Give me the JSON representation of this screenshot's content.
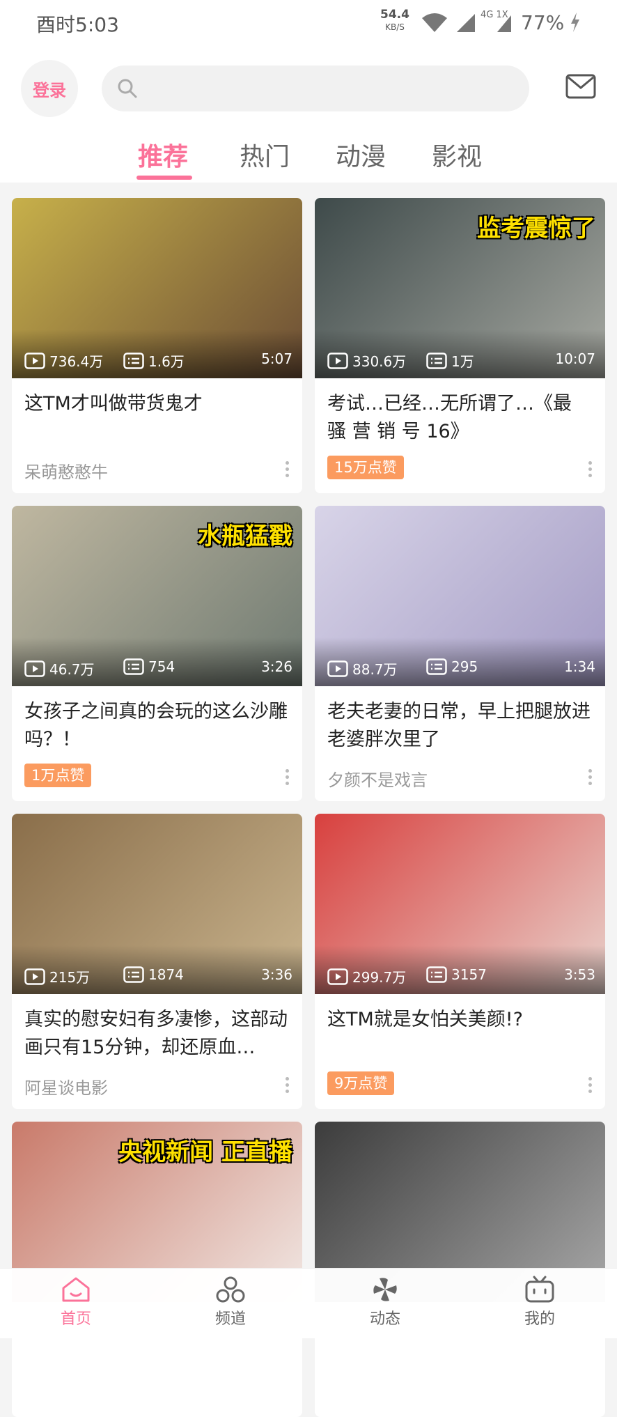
{
  "status_bar": {
    "time": "酉时5:03",
    "net_speed": "54.4",
    "net_unit": "KB/S",
    "network": "4G 1X",
    "battery": "77%"
  },
  "header": {
    "login_label": "登录",
    "search_placeholder": "",
    "tabs": [
      {
        "label": "推荐",
        "active": true
      },
      {
        "label": "热门",
        "active": false
      },
      {
        "label": "动漫",
        "active": false
      },
      {
        "label": "影视",
        "active": false
      }
    ]
  },
  "cards": [
    {
      "views": "736.4万",
      "comments": "1.6万",
      "duration": "5:07",
      "title": "这TM才叫做带货鬼才",
      "author": "呆萌憨憨牛",
      "badge": "",
      "thumb_overlay": "",
      "colors": [
        "#c7b04a",
        "#6b4d35"
      ]
    },
    {
      "views": "330.6万",
      "comments": "1万",
      "duration": "10:07",
      "title": "考试…已经…无所谓了…《最 骚 营 销 号 16》",
      "author": "",
      "badge": "15万点赞",
      "thumb_overlay": "监考震惊了",
      "colors": [
        "#3e4a4a",
        "#a7a9a2"
      ]
    },
    {
      "views": "46.7万",
      "comments": "754",
      "duration": "3:26",
      "title": "女孩子之间真的会玩的这么沙雕吗？！",
      "author": "",
      "badge": "1万点赞",
      "thumb_overlay": "水瓶猛戳",
      "colors": [
        "#bfb7a0",
        "#6f7a72"
      ]
    },
    {
      "views": "88.7万",
      "comments": "295",
      "duration": "1:34",
      "title": "老夫老妻的日常，早上把腿放进老婆胖次里了",
      "author": "夕颜不是戏言",
      "badge": "",
      "thumb_overlay": "",
      "colors": [
        "#d8d4e8",
        "#a39bc4"
      ]
    },
    {
      "views": "215万",
      "comments": "1874",
      "duration": "3:36",
      "title": "真实的慰安妇有多凄惨，这部动画只有15分钟，却还原血…",
      "author": "阿星谈电影",
      "badge": "",
      "thumb_overlay": "",
      "colors": [
        "#8a6e4a",
        "#c9b48e"
      ]
    },
    {
      "views": "299.7万",
      "comments": "3157",
      "duration": "3:53",
      "title": "这TM就是女怕关美颜!?",
      "author": "",
      "badge": "9万点赞",
      "thumb_overlay": "",
      "colors": [
        "#d8403e",
        "#e8d2cc"
      ]
    },
    {
      "views": "",
      "comments": "",
      "duration": "",
      "title": "",
      "author": "",
      "badge": "",
      "thumb_overlay": "央视新闻 正直播",
      "colors": [
        "#c97a6a",
        "#f1e8e4"
      ]
    },
    {
      "views": "",
      "comments": "",
      "duration": "",
      "title": "",
      "author": "",
      "badge": "",
      "thumb_overlay": "",
      "colors": [
        "#3c3c3c",
        "#a8a8a8"
      ]
    }
  ],
  "bottom_nav": [
    {
      "label": "首页",
      "icon": "home-icon",
      "active": true
    },
    {
      "label": "频道",
      "icon": "channel-icon",
      "active": false
    },
    {
      "label": "动态",
      "icon": "dynamic-icon",
      "active": false
    },
    {
      "label": "我的",
      "icon": "tv-icon",
      "active": false
    }
  ],
  "colors": {
    "accent": "#fb7299",
    "badge": "#fb9b5f"
  }
}
